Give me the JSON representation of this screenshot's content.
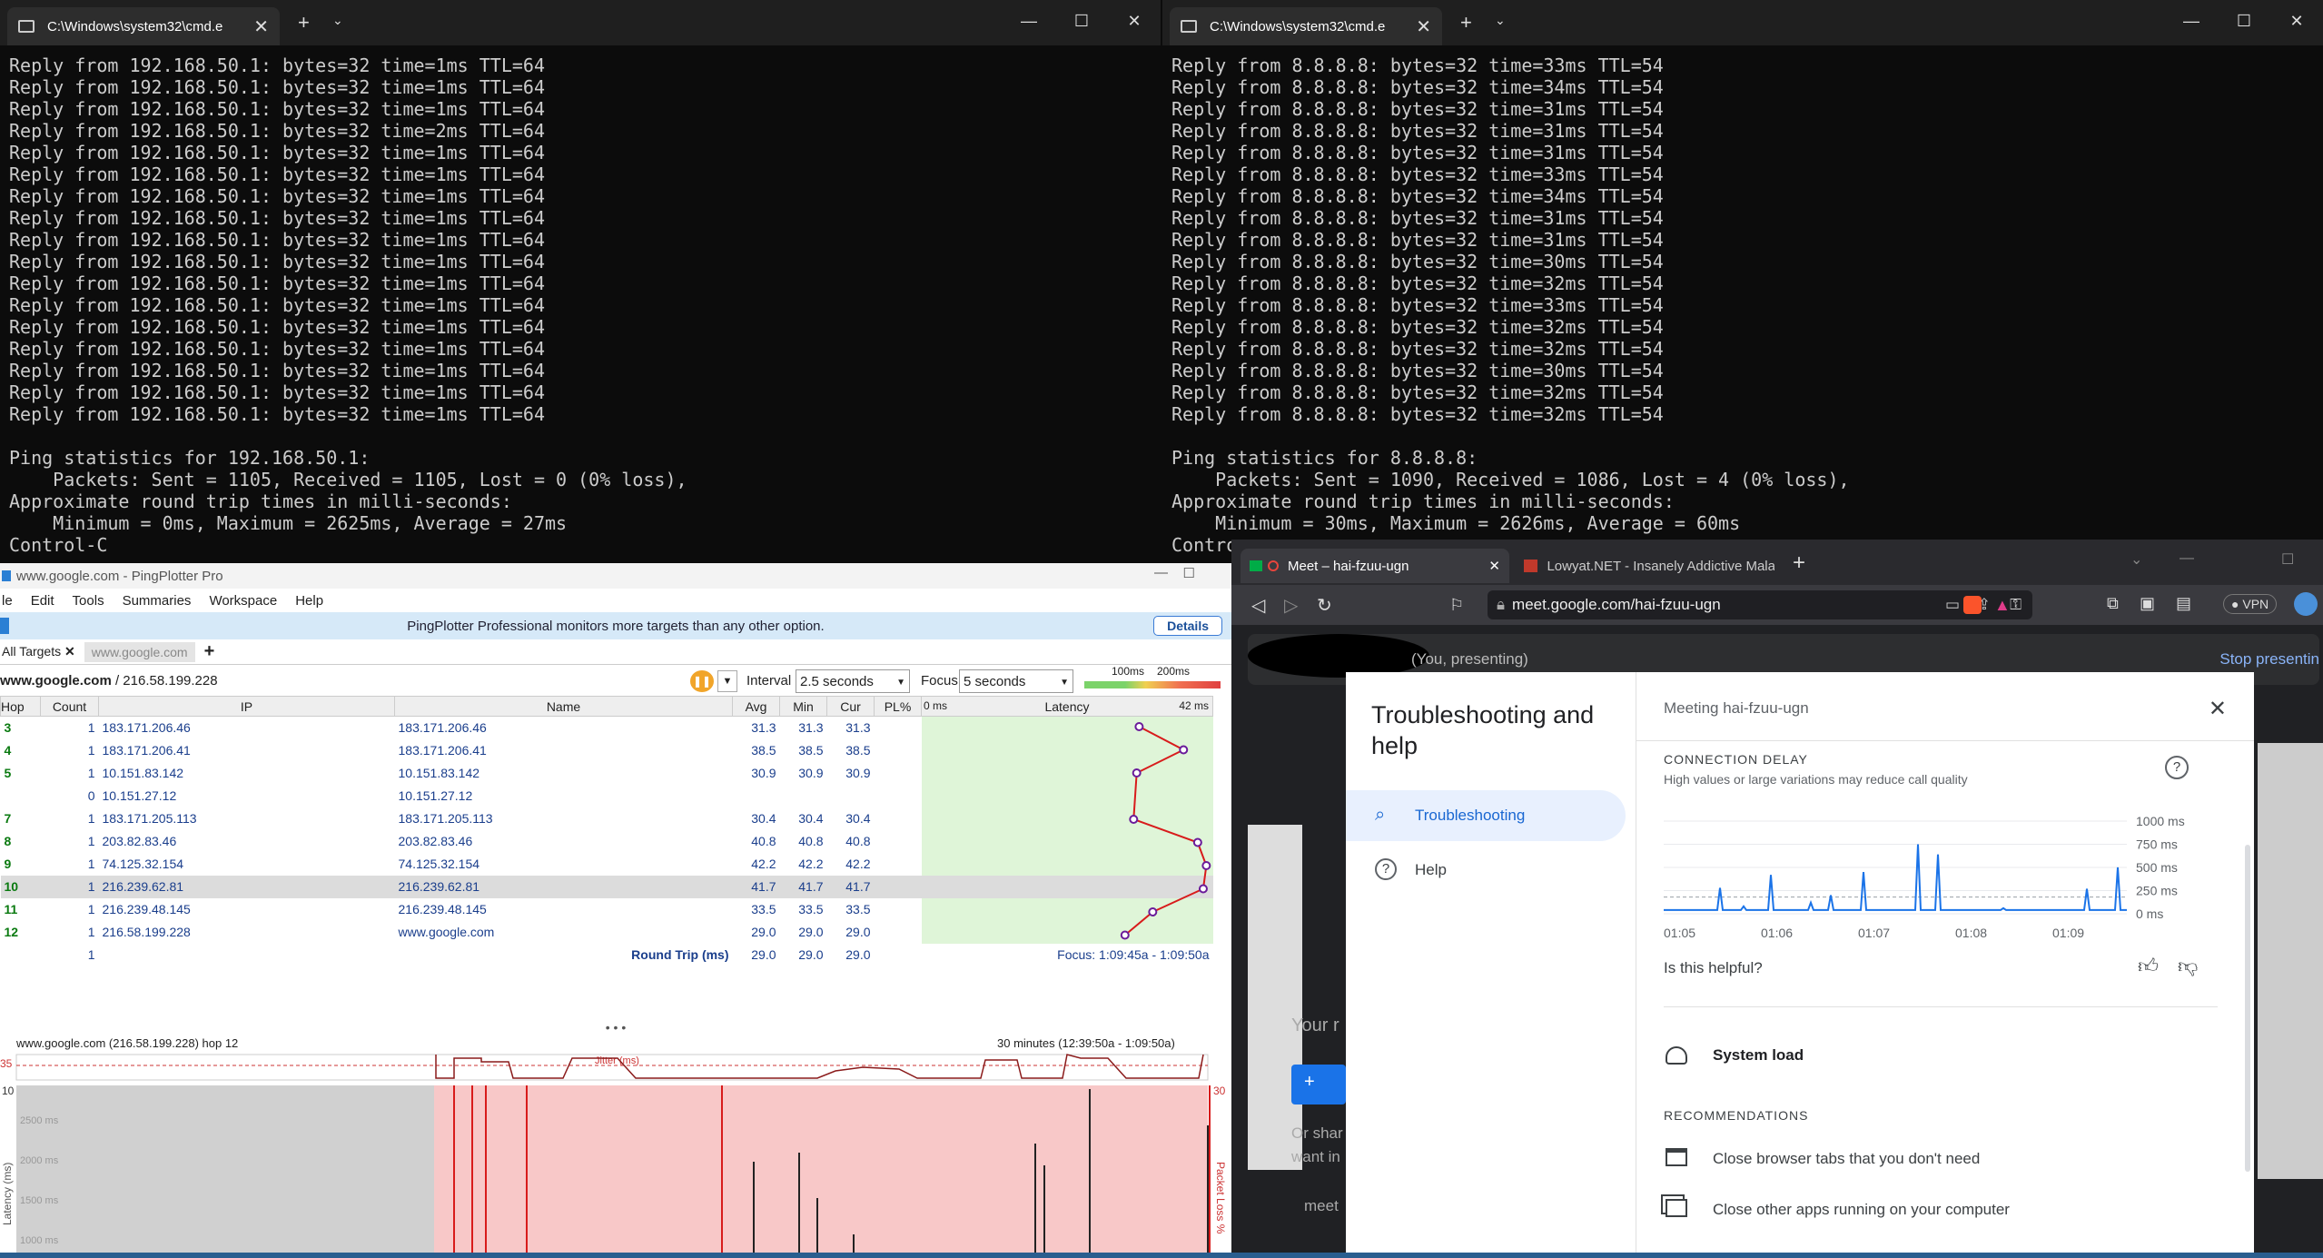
{
  "term_left": {
    "tab_title": "C:\\Windows\\system32\\cmd.e",
    "lines": [
      "Reply from 192.168.50.1: bytes=32 time=1ms TTL=64",
      "Reply from 192.168.50.1: bytes=32 time=1ms TTL=64",
      "Reply from 192.168.50.1: bytes=32 time=1ms TTL=64",
      "Reply from 192.168.50.1: bytes=32 time=2ms TTL=64",
      "Reply from 192.168.50.1: bytes=32 time=1ms TTL=64",
      "Reply from 192.168.50.1: bytes=32 time=1ms TTL=64",
      "Reply from 192.168.50.1: bytes=32 time=1ms TTL=64",
      "Reply from 192.168.50.1: bytes=32 time=1ms TTL=64",
      "Reply from 192.168.50.1: bytes=32 time=1ms TTL=64",
      "Reply from 192.168.50.1: bytes=32 time=1ms TTL=64",
      "Reply from 192.168.50.1: bytes=32 time=1ms TTL=64",
      "Reply from 192.168.50.1: bytes=32 time=1ms TTL=64",
      "Reply from 192.168.50.1: bytes=32 time=1ms TTL=64",
      "Reply from 192.168.50.1: bytes=32 time=1ms TTL=64",
      "Reply from 192.168.50.1: bytes=32 time=1ms TTL=64",
      "Reply from 192.168.50.1: bytes=32 time=1ms TTL=64",
      "Reply from 192.168.50.1: bytes=32 time=1ms TTL=64",
      "",
      "Ping statistics for 192.168.50.1:",
      "    Packets: Sent = 1105, Received = 1105, Lost = 0 (0% loss),",
      "Approximate round trip times in milli-seconds:",
      "    Minimum = 0ms, Maximum = 2625ms, Average = 27ms",
      "Control-C"
    ]
  },
  "term_right": {
    "tab_title": "C:\\Windows\\system32\\cmd.e",
    "lines": [
      "Reply from 8.8.8.8: bytes=32 time=33ms TTL=54",
      "Reply from 8.8.8.8: bytes=32 time=34ms TTL=54",
      "Reply from 8.8.8.8: bytes=32 time=31ms TTL=54",
      "Reply from 8.8.8.8: bytes=32 time=31ms TTL=54",
      "Reply from 8.8.8.8: bytes=32 time=31ms TTL=54",
      "Reply from 8.8.8.8: bytes=32 time=33ms TTL=54",
      "Reply from 8.8.8.8: bytes=32 time=34ms TTL=54",
      "Reply from 8.8.8.8: bytes=32 time=31ms TTL=54",
      "Reply from 8.8.8.8: bytes=32 time=31ms TTL=54",
      "Reply from 8.8.8.8: bytes=32 time=30ms TTL=54",
      "Reply from 8.8.8.8: bytes=32 time=32ms TTL=54",
      "Reply from 8.8.8.8: bytes=32 time=33ms TTL=54",
      "Reply from 8.8.8.8: bytes=32 time=32ms TTL=54",
      "Reply from 8.8.8.8: bytes=32 time=32ms TTL=54",
      "Reply from 8.8.8.8: bytes=32 time=30ms TTL=54",
      "Reply from 8.8.8.8: bytes=32 time=32ms TTL=54",
      "Reply from 8.8.8.8: bytes=32 time=32ms TTL=54",
      "",
      "Ping statistics for 8.8.8.8:",
      "    Packets: Sent = 1090, Received = 1086, Lost = 4 (0% loss),",
      "Approximate round trip times in milli-seconds:",
      "    Minimum = 30ms, Maximum = 2626ms, Average = 60ms",
      "Contro"
    ]
  },
  "pp": {
    "title": "www.google.com - PingPlotter Pro",
    "menu": [
      "le",
      "Edit",
      "Tools",
      "Summaries",
      "Workspace",
      "Help"
    ],
    "promo": "PingPlotter Professional monitors more targets than any other option.",
    "details": "Details",
    "tabs": {
      "all": "All Targets",
      "current": "www.google.com"
    },
    "target": "www.google.com",
    "target_ip": "/ 216.58.199.228",
    "interval_label": "Interval",
    "interval_value": "2.5 seconds",
    "focus_label": "Focus",
    "focus_value": "5 seconds",
    "scale_100": "100ms",
    "scale_200": "200ms",
    "cols": [
      "Hop",
      "Count",
      "IP",
      "Name",
      "Avg",
      "Min",
      "Cur",
      "PL%",
      "Latency"
    ],
    "lat_min": "0 ms",
    "lat_max": "42 ms",
    "rows": [
      {
        "hop": "3",
        "count": "1",
        "ip": "183.171.206.46",
        "name": "183.171.206.46",
        "avg": "31.3",
        "min": "31.3",
        "cur": "31.3"
      },
      {
        "hop": "4",
        "count": "1",
        "ip": "183.171.206.41",
        "name": "183.171.206.41",
        "avg": "38.5",
        "min": "38.5",
        "cur": "38.5"
      },
      {
        "hop": "5",
        "count": "1",
        "ip": "10.151.83.142",
        "name": "10.151.83.142",
        "avg": "30.9",
        "min": "30.9",
        "cur": "30.9"
      },
      {
        "hop": "",
        "count": "0",
        "ip": "10.151.27.12",
        "name": "10.151.27.12",
        "avg": "",
        "min": "",
        "cur": ""
      },
      {
        "hop": "7",
        "count": "1",
        "ip": "183.171.205.113",
        "name": "183.171.205.113",
        "avg": "30.4",
        "min": "30.4",
        "cur": "30.4"
      },
      {
        "hop": "8",
        "count": "1",
        "ip": "203.82.83.46",
        "name": "203.82.83.46",
        "avg": "40.8",
        "min": "40.8",
        "cur": "40.8"
      },
      {
        "hop": "9",
        "count": "1",
        "ip": "74.125.32.154",
        "name": "74.125.32.154",
        "avg": "42.2",
        "min": "42.2",
        "cur": "42.2"
      },
      {
        "hop": "10",
        "count": "1",
        "ip": "216.239.62.81",
        "name": "216.239.62.81",
        "avg": "41.7",
        "min": "41.7",
        "cur": "41.7"
      },
      {
        "hop": "11",
        "count": "1",
        "ip": "216.239.48.145",
        "name": "216.239.48.145",
        "avg": "33.5",
        "min": "33.5",
        "cur": "33.5"
      },
      {
        "hop": "12",
        "count": "1",
        "ip": "216.58.199.228",
        "name": "www.google.com",
        "avg": "29.0",
        "min": "29.0",
        "cur": "29.0"
      }
    ],
    "footer": {
      "count": "1",
      "label": "Round Trip (ms)",
      "avg": "29.0",
      "min": "29.0",
      "cur": "29.0",
      "focus": "Focus: 1:09:45a - 1:09:50a"
    },
    "graph": {
      "title": "www.google.com (216.58.199.228) hop 12",
      "range": "30 minutes (12:39:50a - 1:09:50a)",
      "jitter": "Jitter (ms)",
      "jitter_max": "35",
      "lat_max": "10",
      "pl_max": "30",
      "y_ticks": [
        "2500 ms",
        "2000 ms",
        "1500 ms",
        "1000 ms"
      ],
      "ylabel": "Latency (ms)",
      "pl_label": "Packet Loss %"
    }
  },
  "browser": {
    "tab1": "Meet – hai-fzuu-ugn",
    "tab2": "Lowyat.NET - Insanely Addictive Malay",
    "url": "meet.google.com/hai-fzuu-ugn",
    "vpn": "VPN",
    "presenting": "(You, presenting)",
    "stop": "Stop presentin",
    "bg_text": {
      "yourm": "Your r",
      "orshar": "Or shar",
      "wantin": "want in",
      "meet": "meet"
    }
  },
  "dialog": {
    "title": "Troubleshooting and help",
    "nav": [
      {
        "label": "Troubleshooting",
        "icon": "search-icon"
      },
      {
        "label": "Help",
        "icon": "help-icon"
      }
    ],
    "meeting": "Meeting hai-fzuu-ugn",
    "delay_title": "CONNECTION DELAY",
    "delay_sub": "High values or large variations may reduce call quality",
    "yticks": [
      "1000 ms",
      "750 ms",
      "500 ms",
      "250 ms",
      "0 ms"
    ],
    "xticks": [
      "01:05",
      "01:06",
      "01:07",
      "01:08",
      "01:09"
    ],
    "helpful": "Is this helpful?",
    "system_load": "System load",
    "recs_title": "RECOMMENDATIONS",
    "recs": [
      "Close browser tabs that you don't need",
      "Close other apps running on your computer"
    ]
  },
  "chart_data": [
    {
      "type": "line",
      "title": "",
      "series": [
        {
          "name": "",
          "values": [
            31.3,
            38.5,
            30.9,
            30.4,
            40.8,
            42.2,
            41.7,
            33.5,
            29.0
          ]
        }
      ],
      "categories": [
        "3",
        "4",
        "5",
        "7",
        "8",
        "9",
        "10",
        "11",
        "12"
      ],
      "xlim": [
        0,
        42
      ]
    },
    {
      "type": "line",
      "title": "CONNECTION DELAY",
      "ylim": [
        0,
        1000
      ],
      "categories": [
        "01:05",
        "01:06",
        "01:07",
        "01:08",
        "01:09"
      ],
      "series": [
        {
          "name": "",
          "values": [
            40,
            40,
            40,
            40,
            40,
            40,
            40,
            40,
            40,
            40,
            40,
            40,
            40,
            40,
            40,
            40,
            40,
            40,
            40,
            40,
            40,
            40,
            40,
            40,
            40,
            40,
            40,
            40,
            40,
            40
          ]
        }
      ],
      "spikes": [
        {
          "x": "01:05",
          "y": 280
        },
        {
          "x": "01:05",
          "y": 80
        },
        {
          "x": "01:06",
          "y": 420
        },
        {
          "x": "01:06",
          "y": 120
        },
        {
          "x": "01:06",
          "y": 200
        },
        {
          "x": "01:06",
          "y": 450
        },
        {
          "x": "01:07",
          "y": 750
        },
        {
          "x": "01:07",
          "y": 640
        },
        {
          "x": "01:07",
          "y": 100
        },
        {
          "x": "01:08",
          "y": 60
        },
        {
          "x": "01:09",
          "y": 270
        },
        {
          "x": "01:09",
          "y": 500
        }
      ]
    }
  ]
}
